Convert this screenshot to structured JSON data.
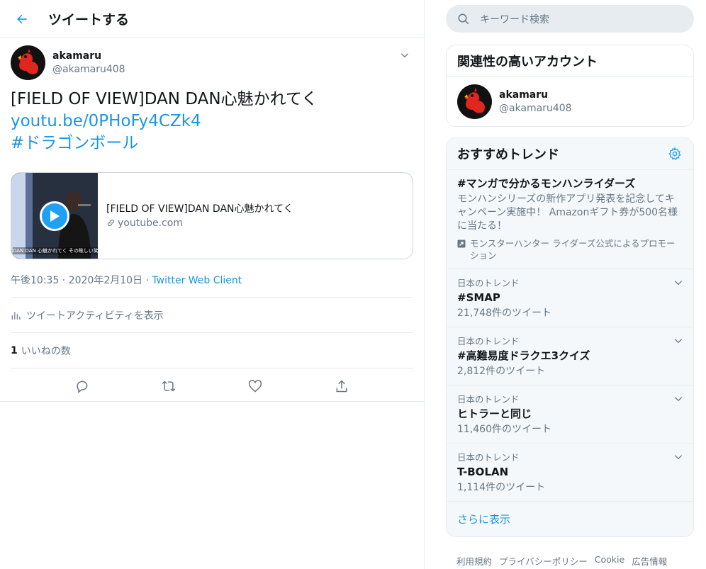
{
  "header": {
    "title": "ツイートする",
    "back_icon": "arrow-left-icon"
  },
  "tweet": {
    "display_name": "akamaru",
    "handle": "@akamaru408",
    "text_line": "[FIELD OF VIEW]DAN DAN心魅かれてく",
    "link": "youtu.be/0PHoFy4CZk4",
    "hashtag": "#ドラゴンボール",
    "card": {
      "title": "[FIELD OF VIEW]DAN DAN心魅かれてく",
      "domain": "youtube.com",
      "thumb_caption": "DAN DAN 心魅かれてく その眩しい笑顔に"
    },
    "timestamp": "午後10:35 · 2020年2月10日",
    "separator": "·",
    "via": "Twitter Web Client",
    "activity_label": "ツイートアクティビティを表示",
    "likes_count": "1",
    "likes_label": "いいねの数"
  },
  "sidebar": {
    "search_placeholder": "キーワード検索",
    "related": {
      "title": "関連性の高いアカウント",
      "display_name": "akamaru",
      "handle": "@akamaru408"
    },
    "trends": {
      "title": "おすすめトレンド",
      "promo": {
        "name": "#マンガで分かるモンハンライダーズ",
        "description": "モンハンシリーズの新作アプリ発表を記念してキャンペーン実施中！ Amazonギフト券が500名様に当たる！",
        "promoted_by": "モンスターハンター ライダーズ公式によるプロモーション"
      },
      "items": [
        {
          "context": "日本のトレンド",
          "name": "#SMAP",
          "count": "21,748件のツイート"
        },
        {
          "context": "日本のトレンド",
          "name": "#高難易度ドラクエ3クイズ",
          "count": "2,812件のツイート"
        },
        {
          "context": "日本のトレンド",
          "name": "ヒトラーと同じ",
          "count": "11,460件のツイート"
        },
        {
          "context": "日本のトレンド",
          "name": "T-BOLAN",
          "count": "1,114件のツイート"
        }
      ],
      "show_more": "さらに表示"
    },
    "footer": [
      "利用規約",
      "プライバシーポリシー",
      "Cookie",
      "広告情報"
    ]
  },
  "colors": {
    "accent": "#1da1f2",
    "link": "#1b95e0",
    "muted": "#657786",
    "border": "#e6ecf0"
  }
}
